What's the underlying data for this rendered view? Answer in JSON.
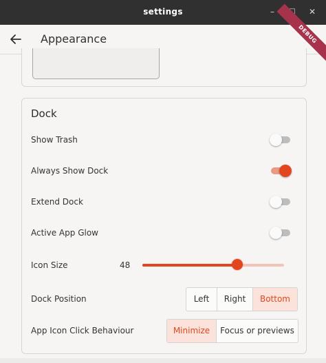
{
  "window": {
    "title": "settings",
    "minimize_glyph": "–",
    "maximize_glyph": "□",
    "close_glyph": "✕"
  },
  "appbar": {
    "title": "Appearance",
    "back_icon": "arrow-left-icon",
    "debug_banner": "DEBUG"
  },
  "colors": {
    "accent": "#e2461e",
    "accent_light": "#fbe3dc",
    "titlebar": "#303030",
    "debug_banner": "#a7324b"
  },
  "dock": {
    "title": "Dock",
    "toggles": [
      {
        "label": "Show Trash",
        "on": false
      },
      {
        "label": "Always Show Dock",
        "on": true
      },
      {
        "label": "Extend Dock",
        "on": false
      },
      {
        "label": "Active App Glow",
        "on": false
      }
    ],
    "icon_size": {
      "label": "Icon Size",
      "value": "48",
      "fraction": 0.67
    },
    "position": {
      "label": "Dock Position",
      "options": [
        "Left",
        "Right",
        "Bottom"
      ],
      "selected": "Bottom"
    },
    "click_behaviour": {
      "label": "App Icon Click Behaviour",
      "options": [
        "Minimize",
        "Focus or previews"
      ],
      "selected": "Minimize"
    }
  }
}
